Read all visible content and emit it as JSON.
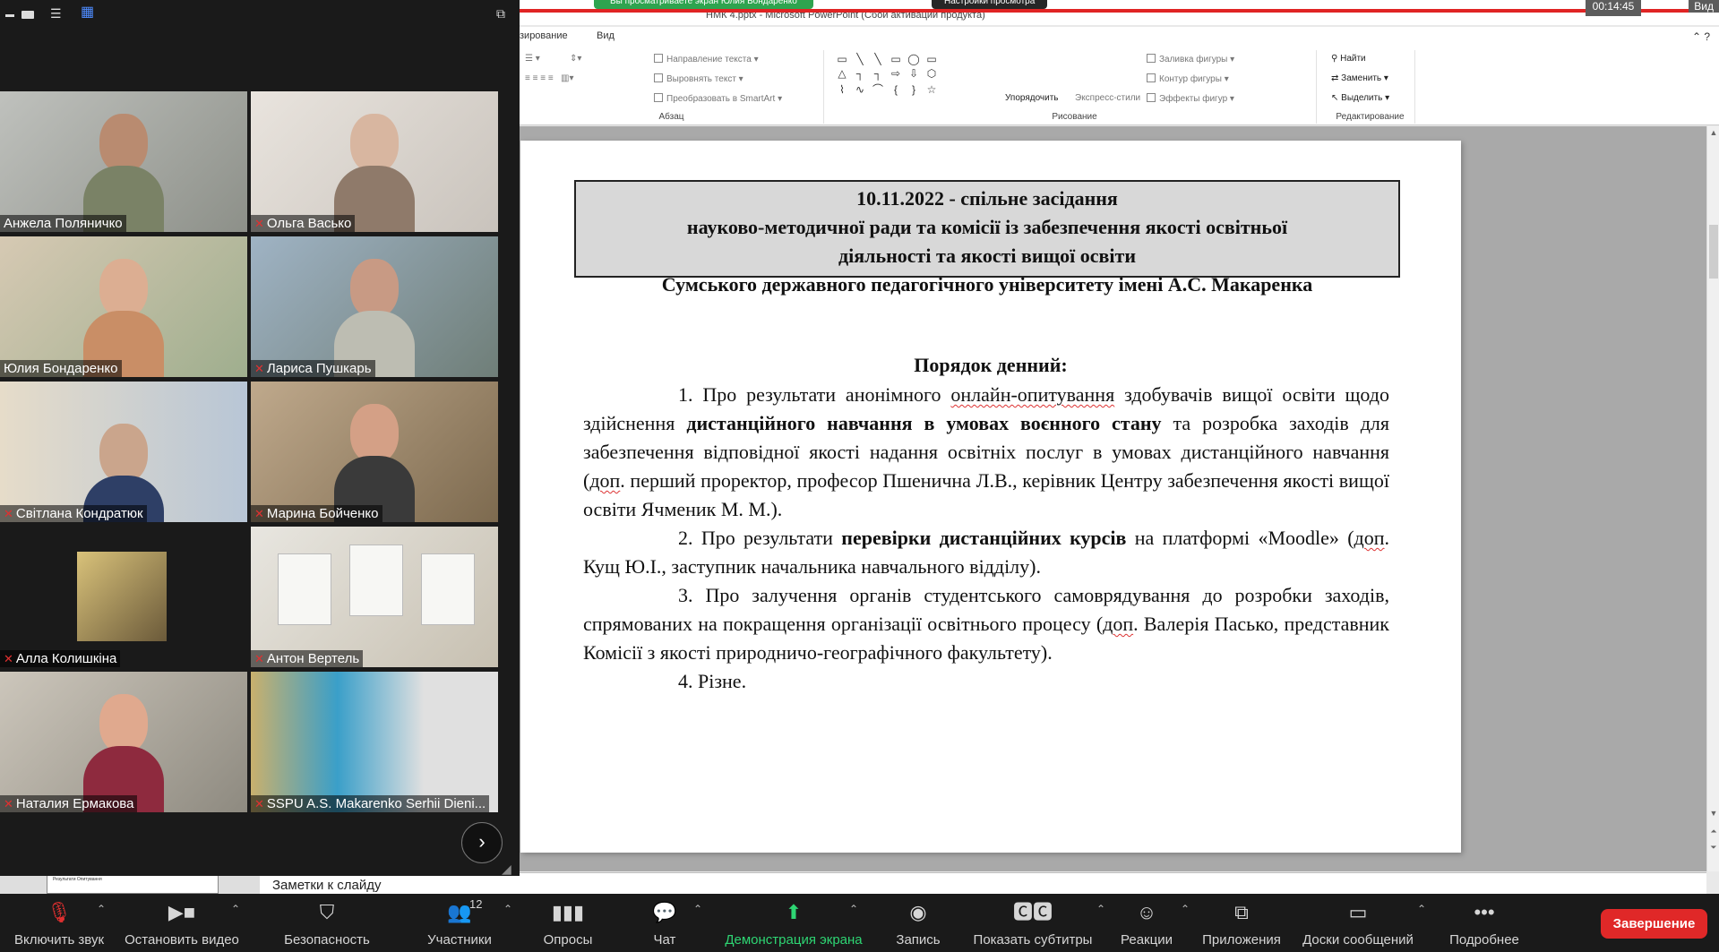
{
  "meeting": {
    "share_banner": "Вы просматриваете экран Юлия Бондаренко",
    "view_options": "Настройки просмотра",
    "timer": "00:14:45",
    "view_label": "Вид"
  },
  "powerpoint": {
    "title": "НМК 4.pptx - Microsoft PowerPoint (Сбой активации продукта)",
    "menu": [
      "зирование",
      "Вид"
    ],
    "ribbon": {
      "paragraph_group": "Абзац",
      "drawing_group": "Рисование",
      "editing_group": "Редактирование",
      "text_direction": "Направление текста",
      "align_text": "Выровнять текст",
      "smartart": "Преобразовать в SmartArt",
      "arrange": "Упорядочить",
      "quick_styles": "Экспресс-стили",
      "shape_fill": "Заливка фигуры",
      "shape_outline": "Контур фигуры",
      "shape_effects": "Эффекты фигур",
      "find": "Найти",
      "replace": "Заменить",
      "select": "Выделить"
    },
    "notes_label": "Заметки к слайду",
    "thumbnail_text": "Результати Опитування",
    "slide": {
      "header_lines": [
        "10.11.2022 -  спільне засідання",
        "науково-методичної ради та комісії із забезпечення якості освітньої",
        "діяльності та якості вищої освіти",
        "Сумського державного  педагогічного університету імені А.С. Макаренка"
      ],
      "agenda_title": "Порядок денний:",
      "item1_a": "1. Про результати анонімного ",
      "item1_b": "онлайн-опитування",
      "item1_c": " здобувачів вищої освіти щодо здійснення ",
      "item1_d": "дистанційного навчання в умовах воєнного стану",
      "item1_e": " та розробка заходів для забезпечення відповідної якості надання освітніх послуг в умовах дистанційного навчання (",
      "item1_f": "доп",
      "item1_g": ". перший проректор, професор Пшенична Л.В., керівник Центру забезпечення якості вищої освіти Ячменик М. М.).",
      "item2_a": "2. Про результати ",
      "item2_b": "перевірки дистанційних курсів",
      "item2_c": " на платформі «Moodle» (",
      "item2_d": "доп",
      "item2_e": ". Кущ Ю.І., заступник начальника навчального відділу).",
      "item3_a": "3. Про залучення органів студентського самоврядування до розробки заходів, спрямованих на покращення організації освітнього процесу (",
      "item3_b": "доп",
      "item3_c": ". Валерія Пасько, представник Комісії з якості природничо-географічного факультету).",
      "item4": "4. Різне."
    }
  },
  "participants": [
    {
      "name": "Анжела Поляничко",
      "muted": false
    },
    {
      "name": "Ольга Васько",
      "muted": true
    },
    {
      "name": "Юлия Бондаренко",
      "muted": false
    },
    {
      "name": "Лариса Пушкарь",
      "muted": true
    },
    {
      "name": "Світлана Кондратюк",
      "muted": true
    },
    {
      "name": "Марина Бойченко",
      "muted": true
    },
    {
      "name": "Алла Колишкіна",
      "muted": true
    },
    {
      "name": "Антон Вертель",
      "muted": true
    },
    {
      "name": "Наталия Ермакова",
      "muted": true
    },
    {
      "name": "SSPU A.S. Makarenko Serhii Dieni...",
      "muted": true
    }
  ],
  "toolbar": {
    "unmute": "Включить звук",
    "stop_video": "Остановить видео",
    "security": "Безопасность",
    "participants": "Участники",
    "participants_count": "12",
    "polls": "Опросы",
    "chat": "Чат",
    "share_screen": "Демонстрация экрана",
    "record": "Запись",
    "captions": "Показать субтитры",
    "reactions": "Реакции",
    "apps": "Приложения",
    "whiteboards": "Доски сообщений",
    "more": "Подробнее",
    "end": "Завершение"
  },
  "colors": {
    "end_button": "#e02828",
    "share_green": "#2ed573",
    "active_speaker": "#d4e048",
    "share_bar_red": "#e02424"
  }
}
